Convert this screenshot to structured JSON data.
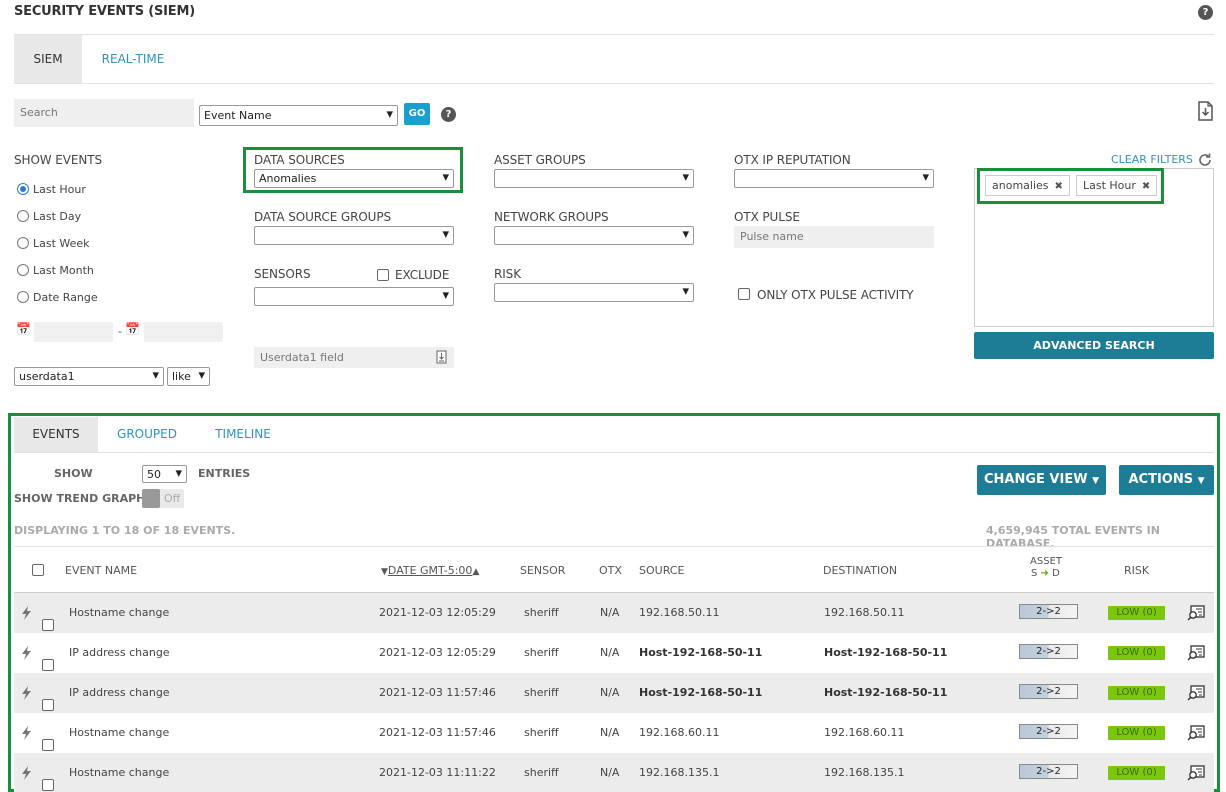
{
  "header": {
    "title": "SECURITY EVENTS (SIEM)"
  },
  "top_tabs": [
    {
      "label": "SIEM"
    },
    {
      "label": "REAL-TIME"
    }
  ],
  "search": {
    "placeholder": "Search",
    "field_select": "Event Name",
    "go_label": "GO"
  },
  "show_events": {
    "label": "SHOW EVENTS",
    "options": [
      "Last Hour",
      "Last Day",
      "Last Week",
      "Last Month",
      "Date Range"
    ],
    "selected": "Last Hour",
    "date_sep": "-"
  },
  "userdata": {
    "field_select": "userdata1",
    "operator_select": "like",
    "input_placeholder": "Userdata1 field"
  },
  "filters": {
    "data_sources": {
      "label": "DATA SOURCES",
      "value": "Anomalies"
    },
    "data_source_groups": {
      "label": "DATA SOURCE GROUPS",
      "value": ""
    },
    "sensors": {
      "label": "SENSORS",
      "value": "",
      "exclude_label": "EXCLUDE"
    },
    "asset_groups": {
      "label": "ASSET GROUPS",
      "value": ""
    },
    "network_groups": {
      "label": "NETWORK GROUPS",
      "value": ""
    },
    "risk": {
      "label": "RISK",
      "value": ""
    },
    "otx_ip_reputation": {
      "label": "OTX IP REPUTATION",
      "value": ""
    },
    "otx_pulse": {
      "label": "OTX PULSE",
      "placeholder": "Pulse name"
    },
    "only_otx_pulse_activity": "ONLY OTX PULSE ACTIVITY"
  },
  "active_filters": {
    "clear_label": "CLEAR FILTERS",
    "tags": [
      "anomalies",
      "Last Hour"
    ],
    "advanced_search_label": "ADVANCED SEARCH"
  },
  "results_tabs": [
    {
      "label": "EVENTS"
    },
    {
      "label": "GROUPED"
    },
    {
      "label": "TIMELINE"
    }
  ],
  "controls": {
    "show_label": "SHOW",
    "entries_value": "50",
    "entries_label": "ENTRIES",
    "trend_label": "SHOW TREND GRAPH",
    "trend_state": "Off",
    "change_view_label": "CHANGE VIEW",
    "actions_label": "ACTIONS",
    "displaying": "DISPLAYING 1 TO 18 OF 18 EVENTS.",
    "total": "4,659,945 TOTAL EVENTS IN DATABASE."
  },
  "table": {
    "headers": {
      "event_name": "EVENT NAME",
      "date": "DATE GMT-5:00",
      "sensor": "SENSOR",
      "otx": "OTX",
      "source": "SOURCE",
      "destination": "DESTINATION",
      "asset_line1": "ASSET",
      "asset_s": "S",
      "asset_d": "D",
      "risk": "RISK"
    },
    "rows": [
      {
        "event": "Hostname change",
        "date": "2021-12-03 12:05:29",
        "sensor": "sheriff",
        "otx": "N/A",
        "source": "192.168.50.11",
        "destination": "192.168.50.11",
        "asset": "2->2",
        "risk": "LOW (0)"
      },
      {
        "event": "IP address change",
        "date": "2021-12-03 12:05:29",
        "sensor": "sheriff",
        "otx": "N/A",
        "source": "Host-192-168-50-11",
        "destination": "Host-192-168-50-11",
        "asset": "2->2",
        "risk": "LOW (0)"
      },
      {
        "event": "IP address change",
        "date": "2021-12-03 11:57:46",
        "sensor": "sheriff",
        "otx": "N/A",
        "source": "Host-192-168-50-11",
        "destination": "Host-192-168-50-11",
        "asset": "2->2",
        "risk": "LOW (0)"
      },
      {
        "event": "Hostname change",
        "date": "2021-12-03 11:57:46",
        "sensor": "sheriff",
        "otx": "N/A",
        "source": "192.168.60.11",
        "destination": "192.168.60.11",
        "asset": "2->2",
        "risk": "LOW (0)"
      },
      {
        "event": "Hostname change",
        "date": "2021-12-03 11:11:22",
        "sensor": "sheriff",
        "otx": "N/A",
        "source": "192.168.135.1",
        "destination": "192.168.135.1",
        "asset": "2->2",
        "risk": "LOW (0)"
      }
    ]
  },
  "colors": {
    "accent": "#1d7c96",
    "link": "#2b94c0",
    "highlight": "#1a8f3a",
    "risk_low": "#7ac70e"
  }
}
